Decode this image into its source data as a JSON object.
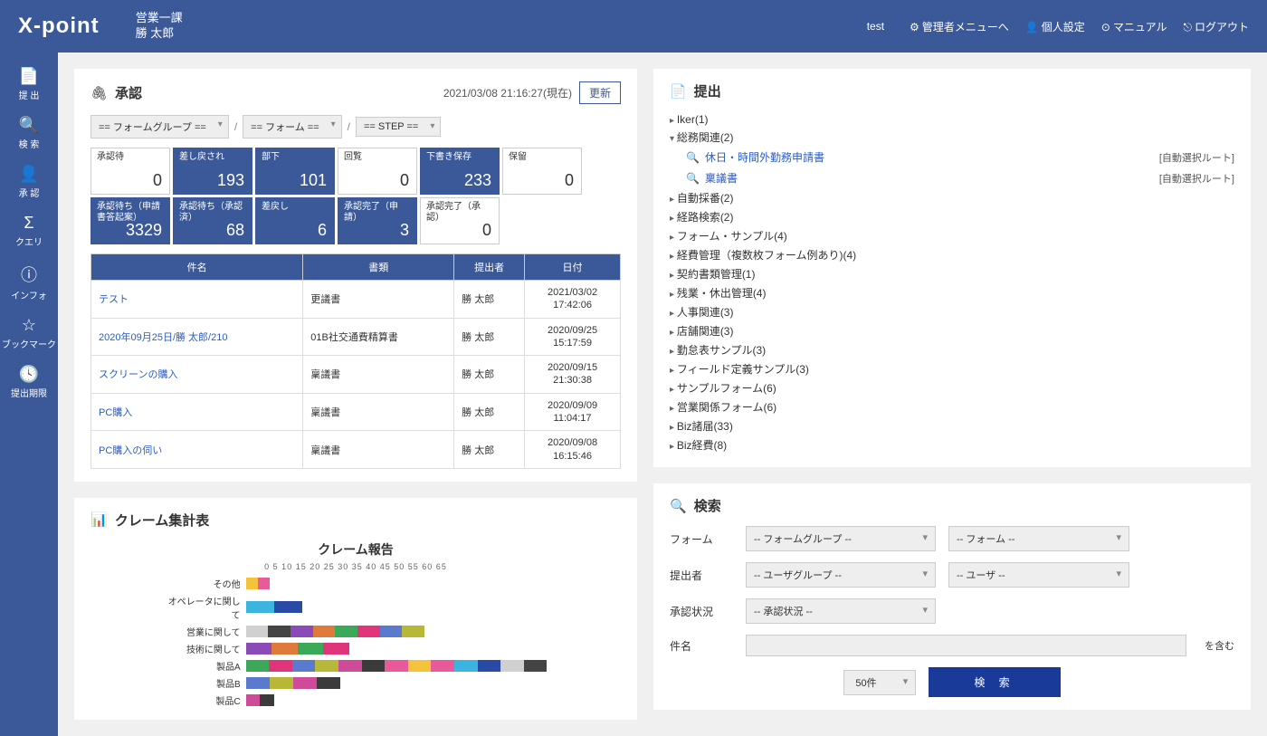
{
  "header": {
    "logo": "X-point",
    "dept": "営業一課",
    "user": "勝 太郎",
    "env": "test",
    "links": {
      "admin": "管理者メニューへ",
      "personal": "個人設定",
      "manual": "マニュアル",
      "logout": "ログアウト"
    }
  },
  "sidebar": [
    {
      "icon": "📄",
      "label": "提 出"
    },
    {
      "icon": "🔍",
      "label": "検 索"
    },
    {
      "icon": "👤",
      "label": "承 認"
    },
    {
      "icon": "Σ",
      "label": "クエリ"
    },
    {
      "icon": "ⓘ",
      "label": "インフォ"
    },
    {
      "icon": "☆",
      "label": "ブックマーク"
    },
    {
      "icon": "🕓",
      "label": "提出期限"
    }
  ],
  "approval": {
    "title": "承認",
    "timestamp": "2021/03/08 21:16:27(現在)",
    "refresh": "更新",
    "filters": {
      "formGroup": "== フォームグループ ==",
      "form": "== フォーム ==",
      "step": "== STEP =="
    },
    "tiles": [
      {
        "label": "承認待",
        "value": "0",
        "dark": false
      },
      {
        "label": "差し戻され",
        "value": "193",
        "dark": true
      },
      {
        "label": "部下",
        "value": "101",
        "dark": true
      },
      {
        "label": "回覧",
        "value": "0",
        "dark": false
      },
      {
        "label": "下書き保存",
        "value": "233",
        "dark": true
      },
      {
        "label": "保留",
        "value": "0",
        "dark": false
      },
      {
        "label": "承認待ち（申請書答起案）",
        "value": "3329",
        "dark": true
      },
      {
        "label": "承認待ち（承認済）",
        "value": "68",
        "dark": true
      },
      {
        "label": "差戻し",
        "value": "6",
        "dark": true
      },
      {
        "label": "承認完了（申請）",
        "value": "3",
        "dark": true
      },
      {
        "label": "承認完了（承認）",
        "value": "0",
        "dark": false
      }
    ],
    "table": {
      "headers": [
        "件名",
        "書類",
        "提出者",
        "日付"
      ],
      "rows": [
        {
          "subject": "テスト",
          "doc": "更議書",
          "submitter": "勝 太郎",
          "date": "2021/03/02\n17:42:06"
        },
        {
          "subject": "2020年09月25日/勝 太郎/210",
          "doc": "01B社交通費精算書",
          "submitter": "勝 太郎",
          "date": "2020/09/25\n15:17:59"
        },
        {
          "subject": "スクリーンの購入",
          "doc": "稟議書",
          "submitter": "勝 太郎",
          "date": "2020/09/15\n21:30:38"
        },
        {
          "subject": "PC購入",
          "doc": "稟議書",
          "submitter": "勝 太郎",
          "date": "2020/09/09\n11:04:17"
        },
        {
          "subject": "PC購入の伺い",
          "doc": "稟議書",
          "submitter": "勝 太郎",
          "date": "2020/09/08\n16:15:46"
        }
      ]
    }
  },
  "claim": {
    "title": "クレーム集計表"
  },
  "chart_data": {
    "type": "bar",
    "orientation": "horizontal",
    "stacked": true,
    "title": "クレーム報告",
    "xlim": [
      0,
      65
    ],
    "xticks": [
      0,
      5,
      10,
      15,
      20,
      25,
      30,
      35,
      40,
      45,
      50,
      55,
      60,
      65
    ],
    "categories": [
      "その他",
      "オペレータに関して",
      "営業に関して",
      "技術に関して",
      "製品A",
      "製品B",
      "製品C"
    ],
    "series_count_approx": 15,
    "totals": [
      5,
      12,
      38,
      22,
      64,
      20,
      6
    ],
    "note": "Totals estimated from bar lengths; stacked segment composition (~15 colored series) read from image, exact per-segment values not labeled."
  },
  "submit": {
    "title": "提出",
    "tree": [
      {
        "label": "Iker(1)",
        "open": false
      },
      {
        "label": "総務関連(2)",
        "open": true,
        "children": [
          {
            "name": "休日・時間外勤務申請書",
            "route": "[自動選択ルート]"
          },
          {
            "name": "稟議書",
            "route": "[自動選択ルート]"
          }
        ]
      },
      {
        "label": "自動採番(2)"
      },
      {
        "label": "経路検索(2)"
      },
      {
        "label": "フォーム・サンプル(4)"
      },
      {
        "label": "経費管理（複数枚フォーム例あり)(4)"
      },
      {
        "label": "契約書類管理(1)"
      },
      {
        "label": "残業・休出管理(4)"
      },
      {
        "label": "人事関連(3)"
      },
      {
        "label": "店舗関連(3)"
      },
      {
        "label": "勤怠表サンプル(3)"
      },
      {
        "label": "フィールド定義サンプル(3)"
      },
      {
        "label": "サンプルフォーム(6)"
      },
      {
        "label": "営業関係フォーム(6)"
      },
      {
        "label": "Biz諸届(33)"
      },
      {
        "label": "Biz経費(8)"
      }
    ]
  },
  "search": {
    "title": "検索",
    "labels": {
      "form": "フォーム",
      "submitter": "提出者",
      "status": "承認状況",
      "subject": "件名"
    },
    "selects": {
      "formGroup": "-- フォームグループ --",
      "form": "-- フォーム --",
      "userGroup": "-- ユーザグループ --",
      "user": "-- ユーザ --",
      "status": "-- 承認状況 --",
      "count": "50件"
    },
    "suffix": "を含む",
    "button": "検 索"
  }
}
